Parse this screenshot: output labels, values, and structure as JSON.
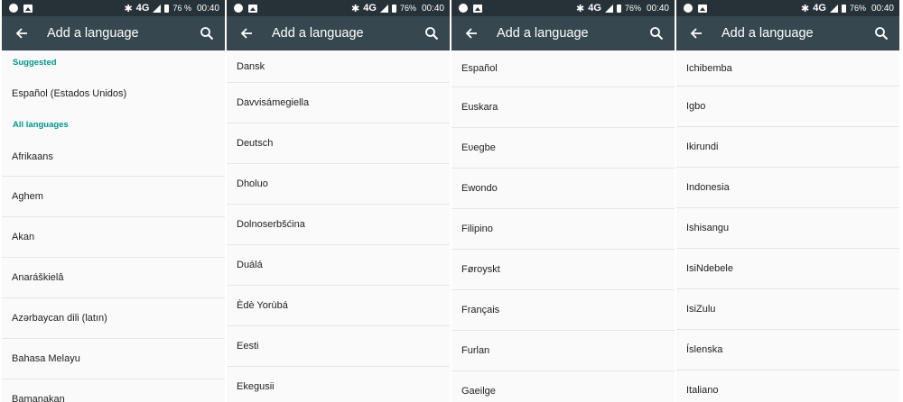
{
  "status_bar": {
    "network": "4G",
    "battery_1": "76 %",
    "battery_2": "76%",
    "battery_3": "76%",
    "battery_4": "76%",
    "time": "00:40"
  },
  "app_bar": {
    "title": "Add a language"
  },
  "panel1": {
    "suggested_header": "Suggested",
    "suggested": [
      "Español (Estados Unidos)"
    ],
    "all_header": "All languages",
    "items": [
      "Afrikaans",
      "Aghem",
      "Akan",
      "Anaráškielâ",
      "Azərbaycan dili (latın)",
      "Bahasa Melayu",
      "Bamanakan"
    ]
  },
  "panel2": {
    "items": [
      "Dansk",
      "Davvisámegiella",
      "Deutsch",
      "Dholuo",
      "Dolnoserbšćina",
      "Duálá",
      "Èdè Yorùbá",
      "Eesti",
      "Ekegusii"
    ]
  },
  "panel3": {
    "items": [
      "Español",
      "Euskara",
      "Eʋegbe",
      "Ewondo",
      "Filipino",
      "Føroyskt",
      "Français",
      "Furlan",
      "Gaeilge"
    ]
  },
  "panel4": {
    "items": [
      "Ichibemba",
      "Igbo",
      "Ikirundi",
      "Indonesia",
      "Ishisangu",
      "IsiNdebele",
      "IsiZulu",
      "Íslenska",
      "Italiano"
    ]
  }
}
